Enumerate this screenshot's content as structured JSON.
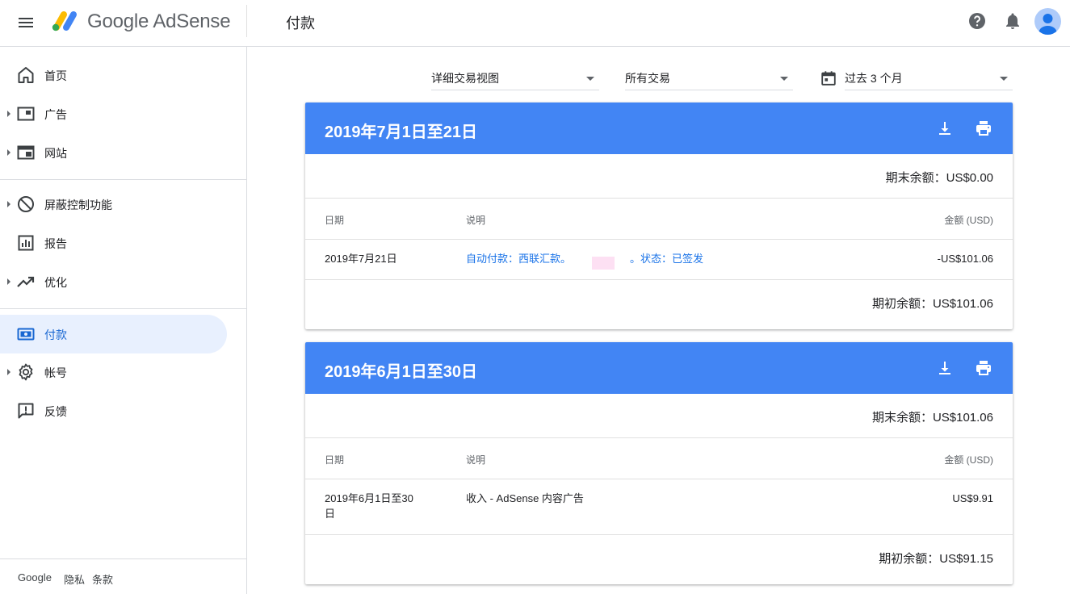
{
  "header": {
    "brand": "Google AdSense",
    "page_title": "付款",
    "icons": [
      "menu-icon",
      "help-icon",
      "bell-icon",
      "avatar"
    ]
  },
  "sidebar": {
    "items": [
      {
        "label": "首页",
        "icon": "home-icon"
      },
      {
        "label": "广告",
        "icon": "ads-icon"
      },
      {
        "label": "网站",
        "icon": "sites-icon"
      },
      {
        "label": "屏蔽控制功能",
        "icon": "block-icon"
      },
      {
        "label": "报告",
        "icon": "reports-icon"
      },
      {
        "label": "优化",
        "icon": "trending-icon"
      },
      {
        "label": "付款",
        "icon": "payments-icon",
        "active": true
      },
      {
        "label": "帐号",
        "icon": "gear-icon"
      },
      {
        "label": "反馈",
        "icon": "feedback-icon"
      }
    ],
    "footer": {
      "google": "Google",
      "privacy": "隐私",
      "terms": "条款"
    }
  },
  "filters": {
    "view": "详细交易视图",
    "type": "所有交易",
    "range": "过去 3 个月"
  },
  "columns": {
    "date": "日期",
    "desc": "说明",
    "amount": "金额 (USD)"
  },
  "cards": [
    {
      "title": "2019年7月1日至21日",
      "end_balance": "期末余额：US$0.00",
      "rows": [
        {
          "date": "2019年7月21日",
          "desc_part1": "自动付款：西联汇款。",
          "desc_part2": "。状态：已签发",
          "amount": "-US$101.06"
        }
      ],
      "start_balance": "期初余额：US$101.06"
    },
    {
      "title": "2019年6月1日至30日",
      "end_balance": "期末余额：US$101.06",
      "rows": [
        {
          "date_line1": "2019年6月1日至30",
          "date_line2": "日",
          "desc": "收入 - AdSense 内容广告",
          "amount": "US$9.91"
        }
      ],
      "start_balance": "期初余额：US$91.15"
    }
  ],
  "colors": {
    "accent": "#4285f4",
    "active_bg": "#e8f0fe",
    "link": "#1a73e8"
  }
}
